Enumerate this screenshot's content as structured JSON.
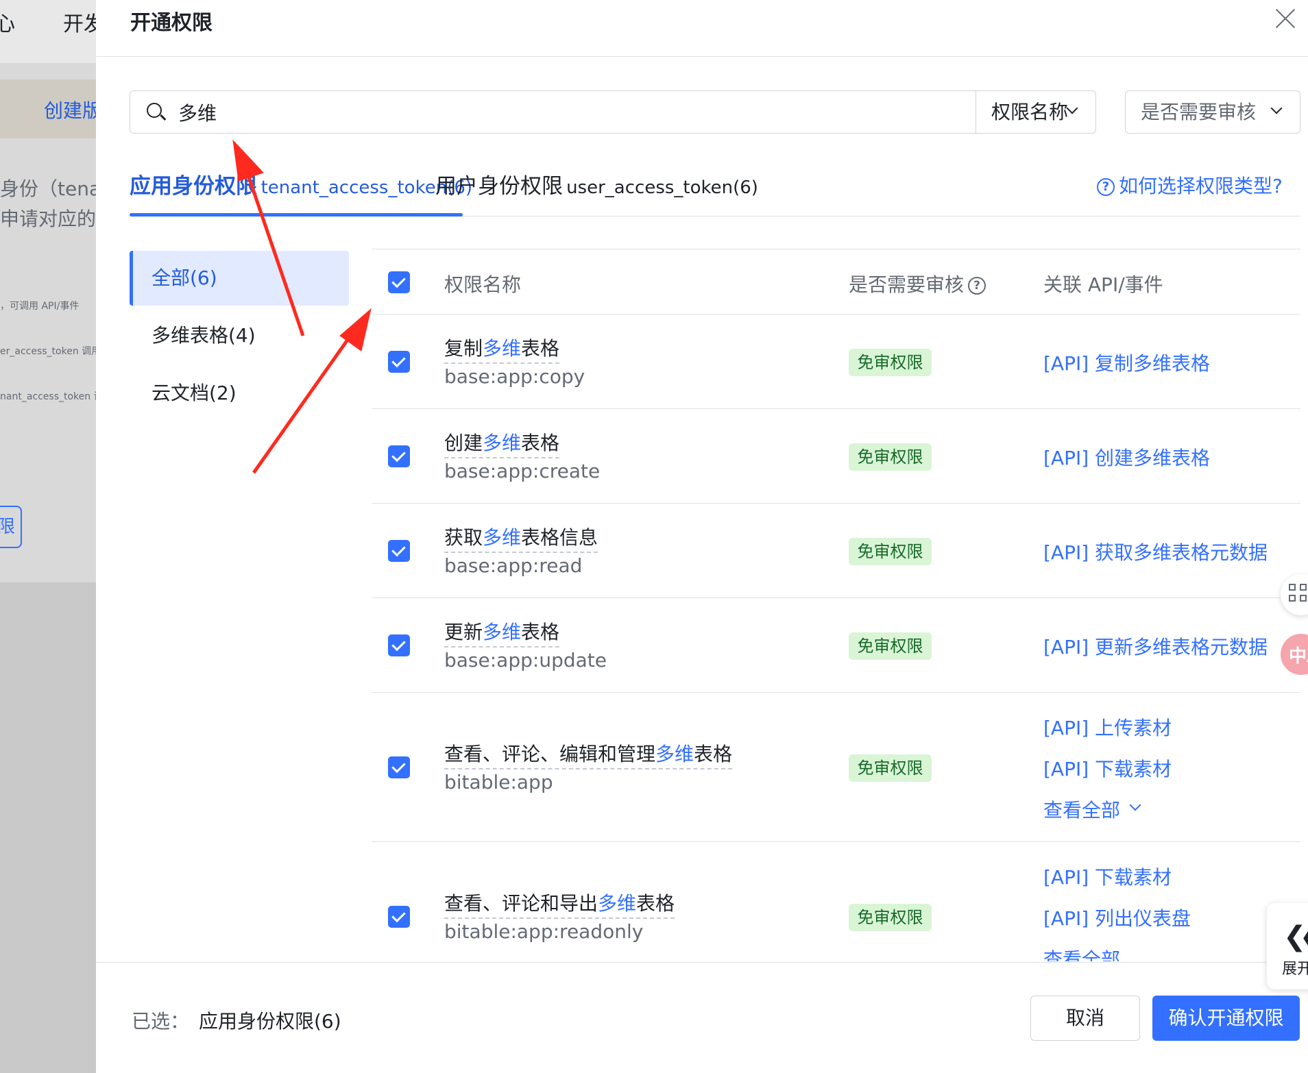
{
  "background": {
    "nav_items": [
      "心",
      "开发"
    ],
    "link": "创建版",
    "lines": [
      "身份（tena",
      "申请对应的"
    ],
    "mini_lines": [
      "，可调用 API/事件",
      "er_access_token 调用",
      "nant_access_token 调"
    ],
    "button_char": "限"
  },
  "modal": {
    "title": "开通权限",
    "search": {
      "value": "多维",
      "field_select": "权限名称",
      "review_filter": "是否需要审核"
    },
    "tabs": [
      {
        "label": "应用身份权限",
        "token": "tenant_access_token(6)",
        "active": true
      },
      {
        "label": "用户身份权限",
        "token": "user_access_token(6)",
        "active": false
      }
    ],
    "help_link": "如何选择权限类型?",
    "sidebar": [
      {
        "label": "全部(6)",
        "active": true
      },
      {
        "label": "多维表格(4)",
        "active": false
      },
      {
        "label": "云文档(2)",
        "active": false
      }
    ],
    "table": {
      "columns": [
        "权限名称",
        "是否需要审核",
        "关联 API/事件"
      ],
      "rows": [
        {
          "name_pre": "复制",
          "name_hl": "多维",
          "name_post": "表格",
          "code": "base:app:copy",
          "review": "免审权限",
          "apis": [
            "[API] 复制多维表格"
          ],
          "more": ""
        },
        {
          "name_pre": "创建",
          "name_hl": "多维",
          "name_post": "表格",
          "code": "base:app:create",
          "review": "免审权限",
          "apis": [
            "[API] 创建多维表格"
          ],
          "more": ""
        },
        {
          "name_pre": "获取",
          "name_hl": "多维",
          "name_post": "表格信息",
          "code": "base:app:read",
          "review": "免审权限",
          "apis": [
            "[API] 获取多维表格元数据"
          ],
          "more": ""
        },
        {
          "name_pre": "更新",
          "name_hl": "多维",
          "name_post": "表格",
          "code": "base:app:update",
          "review": "免审权限",
          "apis": [
            "[API] 更新多维表格元数据"
          ],
          "more": ""
        },
        {
          "name_pre": "查看、评论、编辑和管理",
          "name_hl": "多维",
          "name_post": "表格",
          "code": "bitable:app",
          "review": "免审权限",
          "apis": [
            "[API] 上传素材",
            "[API] 下载素材"
          ],
          "more": "查看全部"
        },
        {
          "name_pre": "查看、评论和导出",
          "name_hl": "多维",
          "name_post": "表格",
          "code": "bitable:app:readonly",
          "review": "免审权限",
          "apis": [
            "[API] 下载素材",
            "[API] 列出仪表盘"
          ],
          "more": "查看全部"
        }
      ]
    },
    "footer": {
      "selected_label": "已选：",
      "selected_value": "应用身份权限(6)",
      "cancel": "取消",
      "confirm": "确认开通权限"
    }
  },
  "floating": {
    "translate_glyph": "中A",
    "expand_label": "展开"
  },
  "colors": {
    "accent": "#3370ff",
    "badge_bg": "#d9f5d6",
    "annotation_arrow": "#ff2a1f"
  }
}
